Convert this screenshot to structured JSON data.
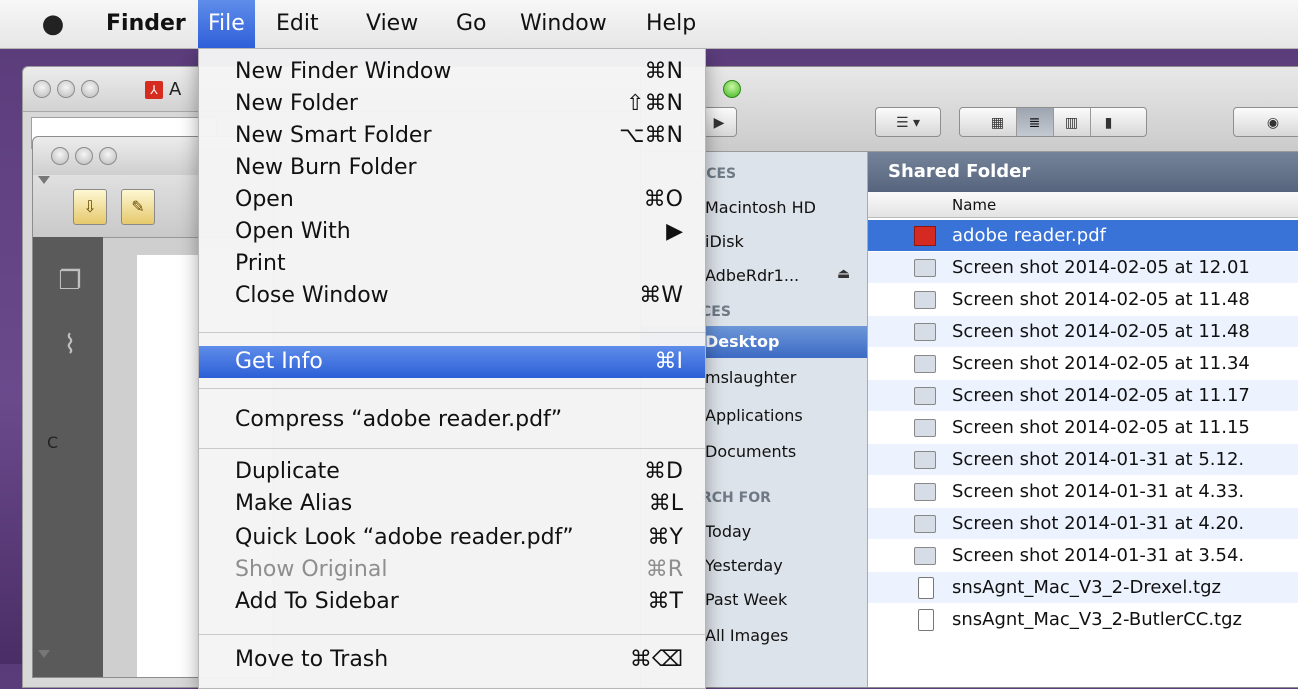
{
  "menubar": {
    "app": "Finder",
    "items": [
      "File",
      "Edit",
      "View",
      "Go",
      "Window",
      "Help"
    ],
    "active": "File"
  },
  "file_menu": {
    "groups": [
      [
        {
          "label": "New Finder Window",
          "shortcut": "⌘N"
        },
        {
          "label": "New Folder",
          "shortcut": "⇧⌘N"
        },
        {
          "label": "New Smart Folder",
          "shortcut": "⌥⌘N"
        },
        {
          "label": "New Burn Folder",
          "shortcut": ""
        },
        {
          "label": "Open",
          "shortcut": "⌘O"
        },
        {
          "label": "Open With",
          "shortcut": "▶"
        },
        {
          "label": "Print",
          "shortcut": ""
        },
        {
          "label": "Close Window",
          "shortcut": "⌘W"
        }
      ],
      [
        {
          "label": "Get Info",
          "shortcut": "⌘I",
          "highlighted": true
        }
      ],
      [
        {
          "label": "Compress “adobe reader.pdf”",
          "shortcut": ""
        }
      ],
      [
        {
          "label": "Duplicate",
          "shortcut": "⌘D"
        },
        {
          "label": "Make Alias",
          "shortcut": "⌘L"
        },
        {
          "label": "Quick Look “adobe reader.pdf”",
          "shortcut": "⌘Y"
        },
        {
          "label": "Show Original",
          "shortcut": "⌘R",
          "disabled": true
        },
        {
          "label": "Add To Sidebar",
          "shortcut": "⌘T"
        }
      ],
      [
        {
          "label": "Move to Trash",
          "shortcut": "⌘⌫"
        }
      ]
    ]
  },
  "reader_window": {
    "title_fragment": "A",
    "left_pane_letter": "C"
  },
  "finder": {
    "sidebar": {
      "devices_header": "ICES",
      "devices": [
        {
          "label": "Macintosh HD"
        },
        {
          "label": "iDisk"
        },
        {
          "label": "AdbeRdr1...",
          "eject": "⏏"
        }
      ],
      "places_header": "CES",
      "places": [
        {
          "label": "Desktop",
          "selected": true
        },
        {
          "label": "mslaughter"
        },
        {
          "label": "Applications"
        },
        {
          "label": "Documents"
        }
      ],
      "search_header": "RCH FOR",
      "search": [
        {
          "label": "Today"
        },
        {
          "label": "Yesterday"
        },
        {
          "label": "Past Week"
        },
        {
          "label": "All Images"
        }
      ]
    },
    "pane": {
      "title": "Shared Folder",
      "column": "Name",
      "files": [
        {
          "name": "adobe reader.pdf",
          "kind": "pdf",
          "selected": true
        },
        {
          "name": "Screen shot 2014-02-05 at 12.01",
          "kind": "image"
        },
        {
          "name": "Screen shot 2014-02-05 at 11.48",
          "kind": "image"
        },
        {
          "name": "Screen shot 2014-02-05 at 11.48",
          "kind": "image"
        },
        {
          "name": "Screen shot 2014-02-05 at 11.34",
          "kind": "image"
        },
        {
          "name": "Screen shot 2014-02-05 at 11.17",
          "kind": "image"
        },
        {
          "name": "Screen shot 2014-02-05 at 11.15",
          "kind": "image"
        },
        {
          "name": "Screen shot 2014-01-31 at 5.12.",
          "kind": "image"
        },
        {
          "name": "Screen shot 2014-01-31 at 4.33.",
          "kind": "image"
        },
        {
          "name": "Screen shot 2014-01-31 at 4.20.",
          "kind": "image"
        },
        {
          "name": "Screen shot 2014-01-31 at 3.54.",
          "kind": "image"
        },
        {
          "name": "snsAgnt_Mac_V3_2-Drexel.tgz",
          "kind": "archive"
        },
        {
          "name": "snsAgnt_Mac_V3_2-ButlerCC.tgz",
          "kind": "archive"
        }
      ]
    },
    "toolbar": {
      "arrange_icon": "arrange-icon",
      "view_modes": [
        "icon-view-icon",
        "list-view-icon",
        "column-view-icon",
        "coverflow-view-icon"
      ],
      "active_view": "list-view-icon",
      "quicklook_icon": "eye-icon"
    }
  },
  "colors": {
    "highlight": "#3a73d8",
    "menu_bg": "#f4f4f4",
    "desktop": "#5a3b7a"
  }
}
